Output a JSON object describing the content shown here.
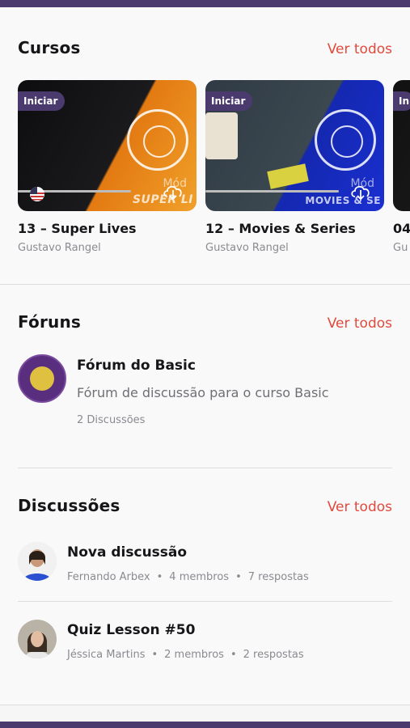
{
  "courses": {
    "title": "Cursos",
    "see_all": "Ver todos",
    "items": [
      {
        "badge": "Iniciar",
        "title": "13 – Super Lives",
        "author": "Gustavo Rangel",
        "overlay": "SUPER LI",
        "modulo": "Mód"
      },
      {
        "badge": "Iniciar",
        "title": "12 – Movies & Series",
        "author": "Gustavo Rangel",
        "overlay": "MOVIES & SE",
        "modulo": "Mód"
      },
      {
        "badge": "Ini",
        "title": "04",
        "author": "Gu"
      }
    ]
  },
  "forums": {
    "title": "Fóruns",
    "see_all": "Ver todos",
    "item": {
      "name": "Fórum do Basic",
      "description": "Fórum de discussão para o curso Basic",
      "count": "2 Discussões"
    }
  },
  "discussions": {
    "title": "Discussões",
    "see_all": "Ver todos",
    "items": [
      {
        "title": "Nova discussão",
        "author": "Fernando Arbex",
        "members": "4 membros",
        "replies": "7 respostas"
      },
      {
        "title": "Quiz Lesson #50",
        "author": "Jéssica Martins",
        "members": "2 membros",
        "replies": "2 respostas"
      }
    ]
  },
  "colors": {
    "brand": "#4a3a6e",
    "accent": "#e04a3c"
  }
}
